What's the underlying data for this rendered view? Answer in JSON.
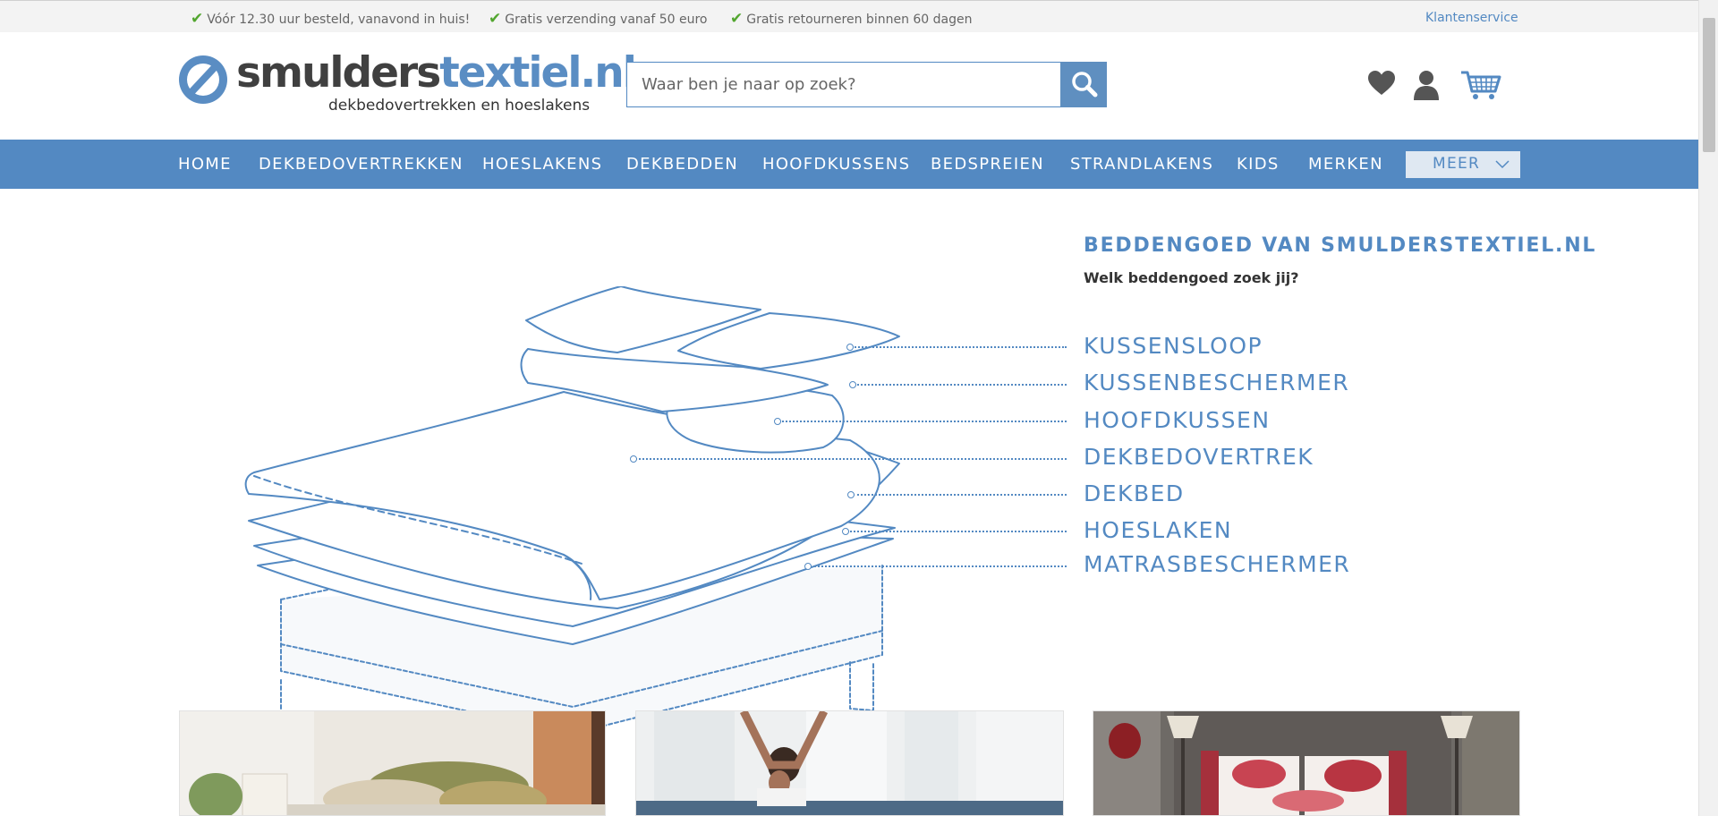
{
  "usp_bar": {
    "items": [
      "Vóór 12.30 uur besteld, vanavond in huis!",
      "Gratis verzending vanaf 50 euro",
      "Gratis retourneren binnen 60 dagen"
    ],
    "check_icon": "check-icon",
    "customer_service": "Klantenservice"
  },
  "header": {
    "logo": {
      "word_dark": "smulders",
      "word_blue": "textiel.nl",
      "tagline": "dekbedovertrekken en hoeslakens"
    },
    "search": {
      "placeholder": "Waar ben je naar op zoek?",
      "button_icon": "search-icon"
    },
    "icons": [
      "heart-icon",
      "user-icon",
      "cart-icon"
    ]
  },
  "nav": {
    "items": [
      "HOME",
      "DEKBEDOVERTREKKEN",
      "HOESLAKENS",
      "DEKBEDDEN",
      "HOOFDKUSSENS",
      "BEDSPREIEN",
      "STRANDLAKENS",
      "KIDS",
      "MERKEN"
    ],
    "more": "MEER"
  },
  "main": {
    "title": "BEDDENGOED VAN SMULDERSTEXTIEL.NL",
    "subtitle": "Welk beddengoed zoek jij?",
    "layers": [
      "KUSSENSLOOP",
      "KUSSENBESCHERMER",
      "HOOFDKUSSEN",
      "DEKBEDOVERTREK",
      "DEKBED",
      "HOESLAKEN",
      "MATRASBESCHERMER"
    ]
  },
  "colors": {
    "brand_blue": "#5389c2",
    "usp_check": "#52a62f",
    "usp_bar_bg": "#f3f3f3"
  }
}
